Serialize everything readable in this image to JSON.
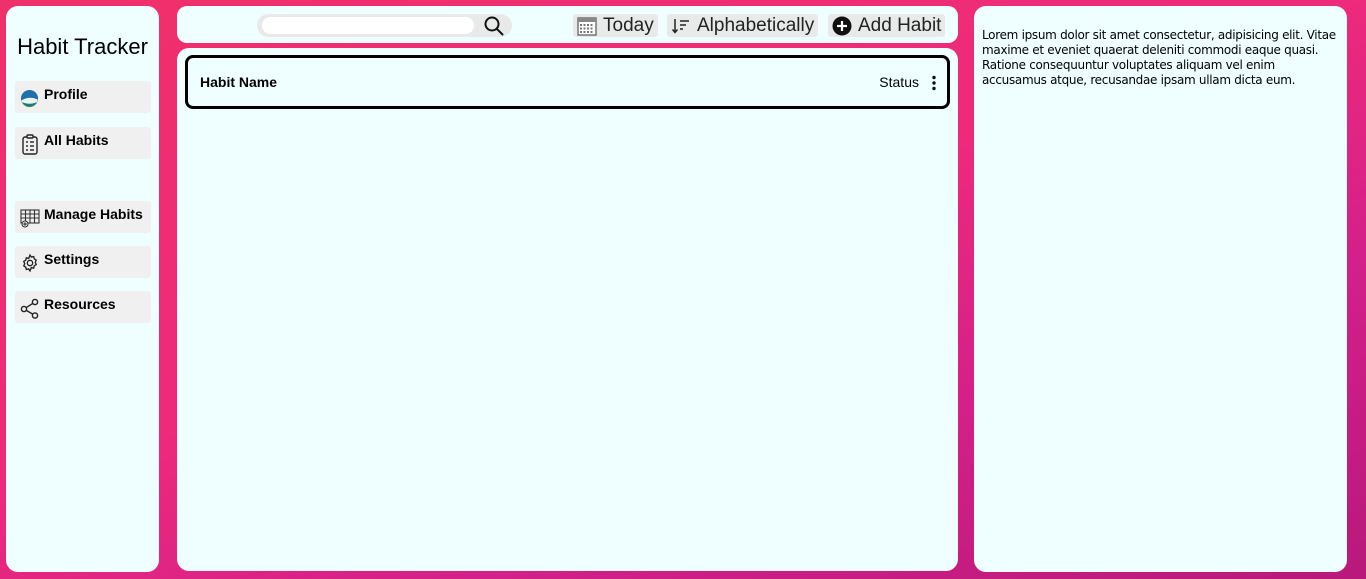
{
  "app": {
    "title": "Habit Tracker"
  },
  "sidebar": {
    "items": [
      {
        "label": "Profile",
        "icon": "avatar-icon"
      },
      {
        "label": "All Habits",
        "icon": "clipboard-list-icon"
      },
      {
        "label": "Manage Habits",
        "icon": "manage-grid-icon"
      },
      {
        "label": "Settings",
        "icon": "gear-icon"
      },
      {
        "label": "Resources",
        "icon": "share-icon"
      }
    ]
  },
  "toolbar": {
    "search": {
      "placeholder": "",
      "value": ""
    },
    "date_label": "Today",
    "sort_label": "Alphabetically",
    "add_label": "Add Habit"
  },
  "table": {
    "header": {
      "name": "Habit Name",
      "status": "Status"
    },
    "rows": []
  },
  "info": {
    "text": "Lorem ipsum dolor sit amet consectetur, adipisicing elit. Vitae maxime et eveniet quaerat deleniti commodi eaque quasi. Ratione consequuntur voluptates aliquam vel enim accusamus atque, recusandae ipsam ullam dicta eum."
  },
  "colors": {
    "background_gradient": [
      "#f0306a",
      "#b8197a"
    ],
    "panel": "#efffff",
    "button": "#e8eaea"
  }
}
